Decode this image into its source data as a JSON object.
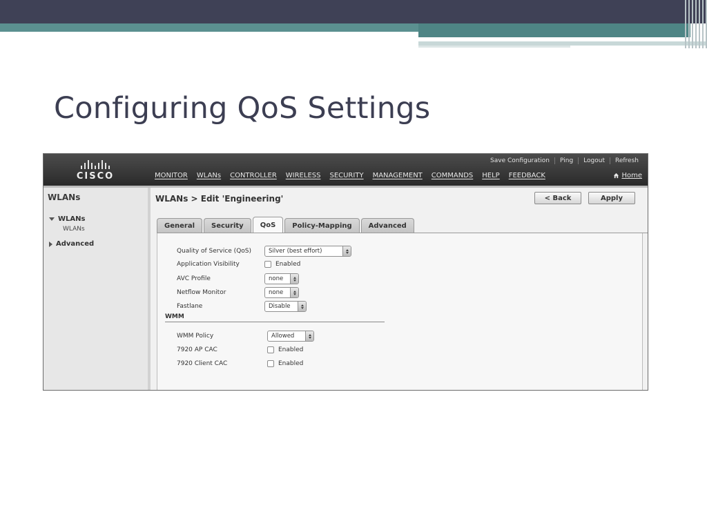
{
  "slide": {
    "title": "Configuring QoS Settings"
  },
  "header": {
    "logo_text": "CISCO",
    "top_links": [
      "Save Configuration",
      "Ping",
      "Logout",
      "Refresh"
    ],
    "nav": [
      "MONITOR",
      "WLANs",
      "CONTROLLER",
      "WIRELESS",
      "SECURITY",
      "MANAGEMENT",
      "COMMANDS",
      "HELP",
      "FEEDBACK"
    ],
    "home": "Home"
  },
  "sidebar": {
    "title": "WLANs",
    "wlans_label": "WLANs",
    "wlans_sub": "WLANs",
    "advanced_label": "Advanced"
  },
  "page": {
    "title": "WLANs > Edit  'Engineering'",
    "back_label": "< Back",
    "apply_label": "Apply"
  },
  "tabs": [
    "General",
    "Security",
    "QoS",
    "Policy-Mapping",
    "Advanced"
  ],
  "active_tab": "QoS",
  "form": {
    "qos": {
      "label": "Quality of Service (QoS)",
      "value": "Silver (best effort)"
    },
    "app_visibility": {
      "label": "Application Visibility",
      "checkbox_label": "Enabled",
      "checked": false
    },
    "avc_profile": {
      "label": "AVC Profile",
      "value": "none"
    },
    "netflow_monitor": {
      "label": "Netflow Monitor",
      "value": "none"
    },
    "fastlane": {
      "label": "Fastlane",
      "value": "Disable"
    },
    "wmm_section": "WMM",
    "wmm_policy": {
      "label": "WMM Policy",
      "value": "Allowed"
    },
    "ap_cac": {
      "label": "7920 AP CAC",
      "checkbox_label": "Enabled",
      "checked": false
    },
    "client_cac": {
      "label": "7920 Client CAC",
      "checkbox_label": "Enabled",
      "checked": false
    }
  },
  "colors": {
    "slide_band": "#3f4156",
    "teal": "#5b9090",
    "title": "#3c3e52",
    "header_dark": "#2a2a2a"
  }
}
